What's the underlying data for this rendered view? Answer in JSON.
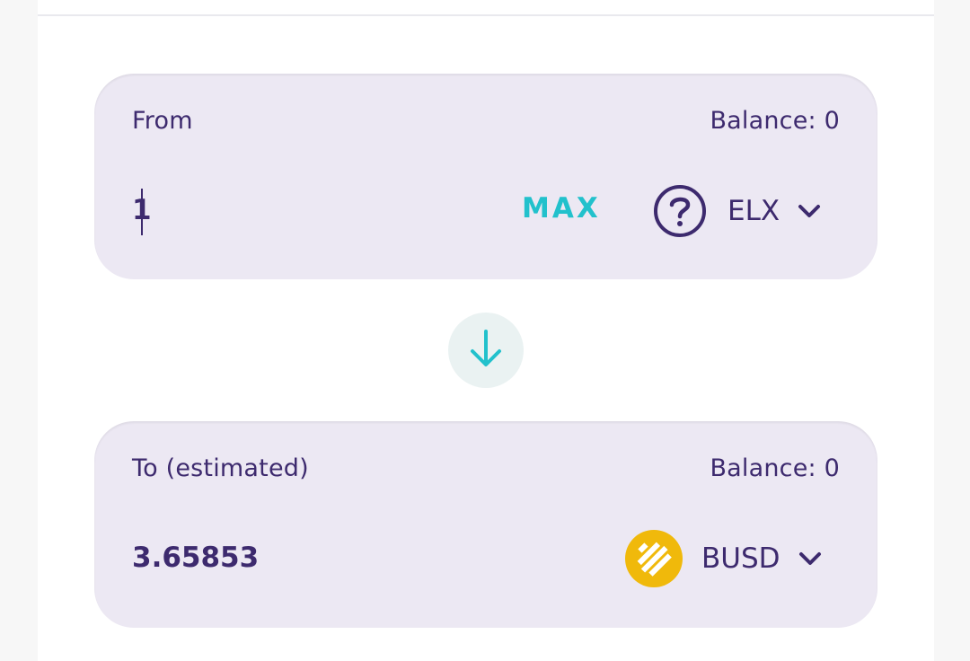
{
  "from": {
    "label": "From",
    "balance": "Balance: 0",
    "amount_value": "1",
    "max_label": "MAX",
    "token": {
      "symbol": "ELX",
      "icon": "question-circle-icon"
    }
  },
  "swap": {
    "icon": "arrow-down-icon"
  },
  "to": {
    "label": "To (estimated)",
    "balance": "Balance: 0",
    "amount": "3.65853",
    "token": {
      "symbol": "BUSD",
      "icon": "busd-coin-icon"
    }
  },
  "colors": {
    "panel_bg": "#ece8f3",
    "text": "#3d2a6e",
    "accent": "#22c1cc",
    "busd": "#f0b90b"
  }
}
